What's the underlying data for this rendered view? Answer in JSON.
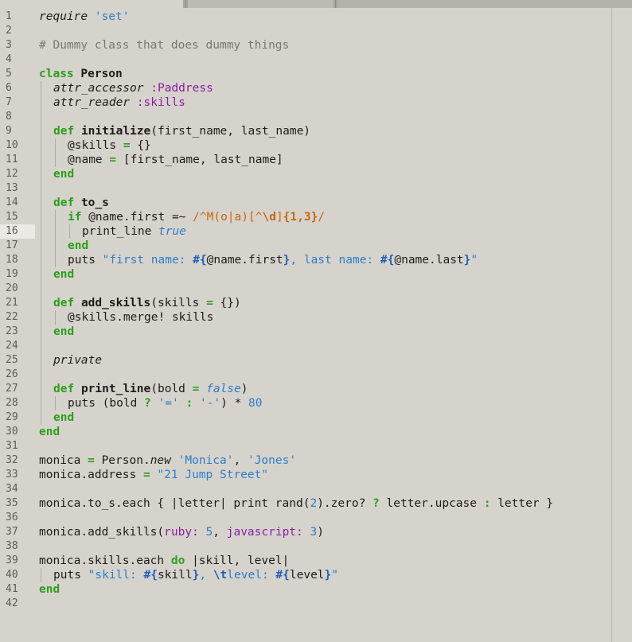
{
  "tabs": [
    {
      "label": ""
    },
    {
      "label": ""
    },
    {
      "label": ""
    }
  ],
  "editor": {
    "current_line": 16,
    "line_count": 42,
    "colors": {
      "background": "#d6d3cc",
      "current_line": "#eceae5",
      "keyword": "#2a9f1a",
      "string": "#2d7ec9",
      "symbol": "#8a1fa6",
      "comment": "#7a7873",
      "regex": "#c7670e"
    },
    "lines": [
      {
        "n": "1",
        "indent": 0,
        "tokens": [
          {
            "t": "require",
            "c": "it"
          },
          {
            "t": " "
          },
          {
            "t": "'set'",
            "c": "str"
          }
        ]
      },
      {
        "n": "2",
        "indent": 0,
        "tokens": []
      },
      {
        "n": "3",
        "indent": 0,
        "tokens": [
          {
            "t": "# Dummy class that does dummy things",
            "c": "cm"
          }
        ]
      },
      {
        "n": "4",
        "indent": 0,
        "tokens": []
      },
      {
        "n": "5",
        "indent": 0,
        "tokens": [
          {
            "t": "class",
            "c": "kw"
          },
          {
            "t": " "
          },
          {
            "t": "Person",
            "c": "def"
          }
        ]
      },
      {
        "n": "6",
        "indent": 1,
        "tokens": [
          {
            "t": "attr_accessor",
            "c": "it"
          },
          {
            "t": " "
          },
          {
            "t": ":Paddress",
            "c": "sym"
          }
        ]
      },
      {
        "n": "7",
        "indent": 1,
        "tokens": [
          {
            "t": "attr_reader",
            "c": "it"
          },
          {
            "t": " "
          },
          {
            "t": ":skills",
            "c": "sym"
          }
        ]
      },
      {
        "n": "8",
        "indent": 1,
        "tokens": []
      },
      {
        "n": "9",
        "indent": 1,
        "tokens": [
          {
            "t": "def",
            "c": "kw"
          },
          {
            "t": " "
          },
          {
            "t": "initialize",
            "c": "def"
          },
          {
            "t": "(first_name, last_name)"
          }
        ]
      },
      {
        "n": "10",
        "indent": 2,
        "tokens": [
          {
            "t": "@skills "
          },
          {
            "t": "=",
            "c": "op"
          },
          {
            "t": " {}"
          }
        ]
      },
      {
        "n": "11",
        "indent": 2,
        "tokens": [
          {
            "t": "@name "
          },
          {
            "t": "=",
            "c": "op"
          },
          {
            "t": " [first_name, last_name]"
          }
        ]
      },
      {
        "n": "12",
        "indent": 1,
        "tokens": [
          {
            "t": "end",
            "c": "kw"
          }
        ]
      },
      {
        "n": "13",
        "indent": 1,
        "tokens": []
      },
      {
        "n": "14",
        "indent": 1,
        "tokens": [
          {
            "t": "def",
            "c": "kw"
          },
          {
            "t": " "
          },
          {
            "t": "to_s",
            "c": "def"
          }
        ]
      },
      {
        "n": "15",
        "indent": 2,
        "tokens": [
          {
            "t": "if",
            "c": "kw"
          },
          {
            "t": " @name.first =~ "
          },
          {
            "t": "/^M(o|a)[^",
            "c": "re"
          },
          {
            "t": "\\d",
            "c": "reb"
          },
          {
            "t": "]",
            "c": "re"
          },
          {
            "t": "{1,3}",
            "c": "reb"
          },
          {
            "t": "/",
            "c": "re"
          }
        ]
      },
      {
        "n": "16",
        "indent": 3,
        "tokens": [
          {
            "t": "print_line "
          },
          {
            "t": "true",
            "c": "blue-it"
          }
        ]
      },
      {
        "n": "17",
        "indent": 2,
        "tokens": [
          {
            "t": "end",
            "c": "kw"
          }
        ]
      },
      {
        "n": "18",
        "indent": 2,
        "tokens": [
          {
            "t": "puts "
          },
          {
            "t": "\"first name: ",
            "c": "str"
          },
          {
            "t": "#{",
            "c": "esc"
          },
          {
            "t": "@name.first"
          },
          {
            "t": "}",
            "c": "esc"
          },
          {
            "t": ", last name: ",
            "c": "str"
          },
          {
            "t": "#{",
            "c": "esc"
          },
          {
            "t": "@name.last"
          },
          {
            "t": "}",
            "c": "esc"
          },
          {
            "t": "\"",
            "c": "str"
          }
        ]
      },
      {
        "n": "19",
        "indent": 1,
        "tokens": [
          {
            "t": "end",
            "c": "kw"
          }
        ]
      },
      {
        "n": "20",
        "indent": 1,
        "tokens": []
      },
      {
        "n": "21",
        "indent": 1,
        "tokens": [
          {
            "t": "def",
            "c": "kw"
          },
          {
            "t": " "
          },
          {
            "t": "add_skills",
            "c": "def"
          },
          {
            "t": "(skills "
          },
          {
            "t": "=",
            "c": "op"
          },
          {
            "t": " {})"
          }
        ]
      },
      {
        "n": "22",
        "indent": 2,
        "tokens": [
          {
            "t": "@skills.merge! skills"
          }
        ]
      },
      {
        "n": "23",
        "indent": 1,
        "tokens": [
          {
            "t": "end",
            "c": "kw"
          }
        ]
      },
      {
        "n": "24",
        "indent": 1,
        "tokens": []
      },
      {
        "n": "25",
        "indent": 1,
        "tokens": [
          {
            "t": "private",
            "c": "it"
          }
        ]
      },
      {
        "n": "26",
        "indent": 1,
        "tokens": []
      },
      {
        "n": "27",
        "indent": 1,
        "tokens": [
          {
            "t": "def",
            "c": "kw"
          },
          {
            "t": " "
          },
          {
            "t": "print_line",
            "c": "def"
          },
          {
            "t": "(bold "
          },
          {
            "t": "=",
            "c": "op"
          },
          {
            "t": " "
          },
          {
            "t": "false",
            "c": "blue-it"
          },
          {
            "t": ")"
          }
        ]
      },
      {
        "n": "28",
        "indent": 2,
        "tokens": [
          {
            "t": "puts (bold "
          },
          {
            "t": "?",
            "c": "op"
          },
          {
            "t": " "
          },
          {
            "t": "'='",
            "c": "str"
          },
          {
            "t": " "
          },
          {
            "t": ":",
            "c": "op"
          },
          {
            "t": " "
          },
          {
            "t": "'-'",
            "c": "str"
          },
          {
            "t": ") * "
          },
          {
            "t": "80",
            "c": "num"
          }
        ]
      },
      {
        "n": "29",
        "indent": 1,
        "tokens": [
          {
            "t": "end",
            "c": "kw"
          }
        ]
      },
      {
        "n": "30",
        "indent": 0,
        "tokens": [
          {
            "t": "end",
            "c": "kw"
          }
        ]
      },
      {
        "n": "31",
        "indent": 0,
        "tokens": []
      },
      {
        "n": "32",
        "indent": 0,
        "tokens": [
          {
            "t": "monica "
          },
          {
            "t": "=",
            "c": "op"
          },
          {
            "t": " Person."
          },
          {
            "t": "new",
            "c": "it"
          },
          {
            "t": " "
          },
          {
            "t": "'Monica'",
            "c": "str"
          },
          {
            "t": ", "
          },
          {
            "t": "'Jones'",
            "c": "str"
          }
        ]
      },
      {
        "n": "33",
        "indent": 0,
        "tokens": [
          {
            "t": "monica.address "
          },
          {
            "t": "=",
            "c": "op"
          },
          {
            "t": " "
          },
          {
            "t": "\"21 Jump Street\"",
            "c": "str"
          }
        ]
      },
      {
        "n": "34",
        "indent": 0,
        "tokens": []
      },
      {
        "n": "35",
        "indent": 0,
        "tokens": [
          {
            "t": "monica.to_s.each { |letter| print rand("
          },
          {
            "t": "2",
            "c": "num"
          },
          {
            "t": ").zero? "
          },
          {
            "t": "?",
            "c": "op"
          },
          {
            "t": " letter.upcase "
          },
          {
            "t": ":",
            "c": "op"
          },
          {
            "t": " letter }"
          }
        ]
      },
      {
        "n": "36",
        "indent": 0,
        "tokens": []
      },
      {
        "n": "37",
        "indent": 0,
        "tokens": [
          {
            "t": "monica.add_skills("
          },
          {
            "t": "ruby:",
            "c": "sym"
          },
          {
            "t": " "
          },
          {
            "t": "5",
            "c": "num"
          },
          {
            "t": ", "
          },
          {
            "t": "javascript:",
            "c": "sym"
          },
          {
            "t": " "
          },
          {
            "t": "3",
            "c": "num"
          },
          {
            "t": ")"
          }
        ]
      },
      {
        "n": "38",
        "indent": 0,
        "tokens": []
      },
      {
        "n": "39",
        "indent": 0,
        "tokens": [
          {
            "t": "monica.skills.each "
          },
          {
            "t": "do",
            "c": "kw"
          },
          {
            "t": " |skill, level|"
          }
        ]
      },
      {
        "n": "40",
        "indent": 1,
        "tokens": [
          {
            "t": "puts "
          },
          {
            "t": "\"skill: ",
            "c": "str"
          },
          {
            "t": "#{",
            "c": "esc"
          },
          {
            "t": "skill"
          },
          {
            "t": "}",
            "c": "esc"
          },
          {
            "t": ", ",
            "c": "str"
          },
          {
            "t": "\\t",
            "c": "esc"
          },
          {
            "t": "level: ",
            "c": "str"
          },
          {
            "t": "#{",
            "c": "esc"
          },
          {
            "t": "level"
          },
          {
            "t": "}",
            "c": "esc"
          },
          {
            "t": "\"",
            "c": "str"
          }
        ]
      },
      {
        "n": "41",
        "indent": 0,
        "tokens": [
          {
            "t": "end",
            "c": "kw"
          }
        ]
      },
      {
        "n": "42",
        "indent": 0,
        "tokens": []
      }
    ]
  }
}
